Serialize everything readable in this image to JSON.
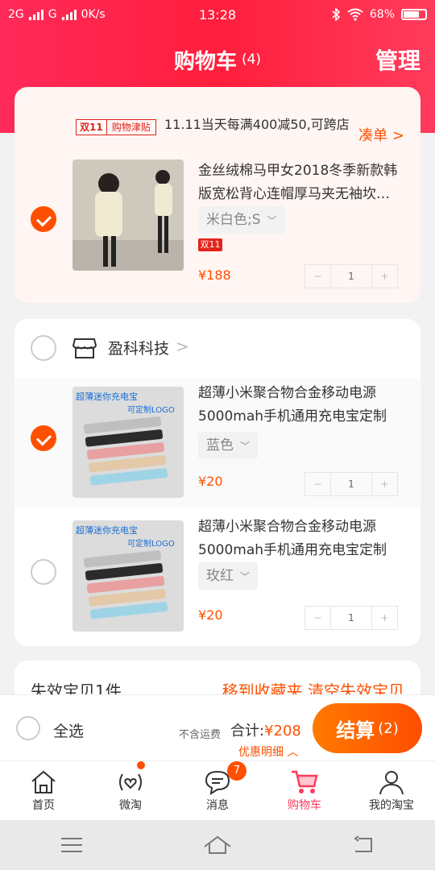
{
  "status_bar": {
    "network_1": "2G",
    "network_2": "G",
    "speed": "0K/s",
    "time": "13:28",
    "battery": "68%"
  },
  "header": {
    "title": "购物车",
    "count": "(4)",
    "manage_label": "管理"
  },
  "shop1": {
    "promo_tag_1": "双11",
    "promo_tag_2": "购物津贴",
    "promo_text": "11.11当天每满400减50,可跨店",
    "promo_link": "凑单",
    "item": {
      "title": "金丝绒棉马甲女2018冬季新款韩版宽松背心连帽厚马夹无袖坎…",
      "sku": "米白色;S",
      "badge": "双11",
      "price": "¥188",
      "qty": "1",
      "checked": true
    }
  },
  "shop2": {
    "name": "盈科科技",
    "items": [
      {
        "title": "超薄小米聚合物合金移动电源5000mah手机通用充电宝定制L…",
        "sku": "蓝色",
        "price": "¥20",
        "qty": "1",
        "checked": true,
        "img_text_1": "超薄迷你充电宝",
        "img_text_2": "可定制LOGO"
      },
      {
        "title": "超薄小米聚合物合金移动电源5000mah手机通用充电宝定制L…",
        "sku": "玫红",
        "price": "¥20",
        "qty": "1",
        "checked": false,
        "img_text_1": "超薄迷你充电宝",
        "img_text_2": "可定制LOGO"
      }
    ]
  },
  "invalid": {
    "title": "失效宝贝1件",
    "actions": "移到收藏夹 清空失效宝贝"
  },
  "bottom_bar": {
    "select_all": "全选",
    "no_shipping": "不含运费",
    "total_label": "合计:",
    "total_value": "¥208",
    "discount_detail": "优惠明细 ︿",
    "checkout_label": "结算",
    "checkout_count": "(2)"
  },
  "tabs": [
    {
      "label": "首页",
      "icon": "home-icon"
    },
    {
      "label": "微淘",
      "icon": "weitao-icon"
    },
    {
      "label": "消息",
      "icon": "message-icon",
      "badge": "7"
    },
    {
      "label": "购物车",
      "icon": "cart-icon",
      "active": true
    },
    {
      "label": "我的淘宝",
      "icon": "profile-icon"
    }
  ],
  "colors": {
    "brand": "#ff5000",
    "header_red": "#ff1e3c",
    "tab_active": "#ff3b5c"
  }
}
